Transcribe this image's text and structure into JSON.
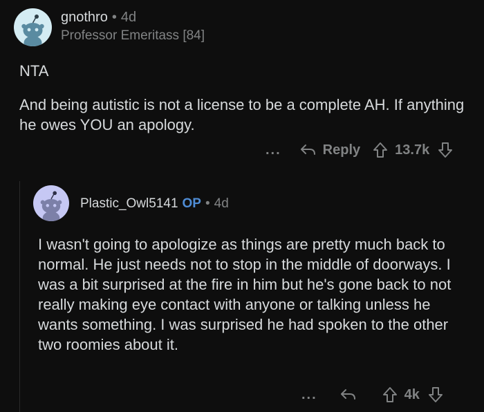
{
  "comment": {
    "username": "gnothro",
    "separator": "•",
    "age": "4d",
    "flair": "Professor Emeritass [84]",
    "body": [
      "NTA",
      "And being autistic is not a license to be a complete AH. If anything he owes YOU an apology."
    ],
    "more": "...",
    "reply_label": "Reply",
    "score": "13.7k"
  },
  "reply": {
    "username": "Plastic_Owl5141",
    "op_badge": "OP",
    "separator": "•",
    "age": "4d",
    "body": "I wasn't going to apologize as things are pretty much back to normal.  He just needs not to stop in the middle of doorways.  I was a bit surprised at the fire in him but he's gone back to not really making eye contact with anyone or talking unless he wants something.  I was surprised he had spoken to the other two roomies about it.",
    "more": "...",
    "score": "4k"
  },
  "colors": {
    "background": "#0e0e0e",
    "text": "#d7dadc",
    "muted": "#818384",
    "op_blue": "#4f8dd6",
    "avatar_bg_1": "#d4ecf3",
    "avatar_bg_2": "#c6c8f4"
  },
  "icons": [
    "snoo-avatar-icon",
    "reply-arrow-icon",
    "upvote-icon",
    "downvote-icon"
  ]
}
